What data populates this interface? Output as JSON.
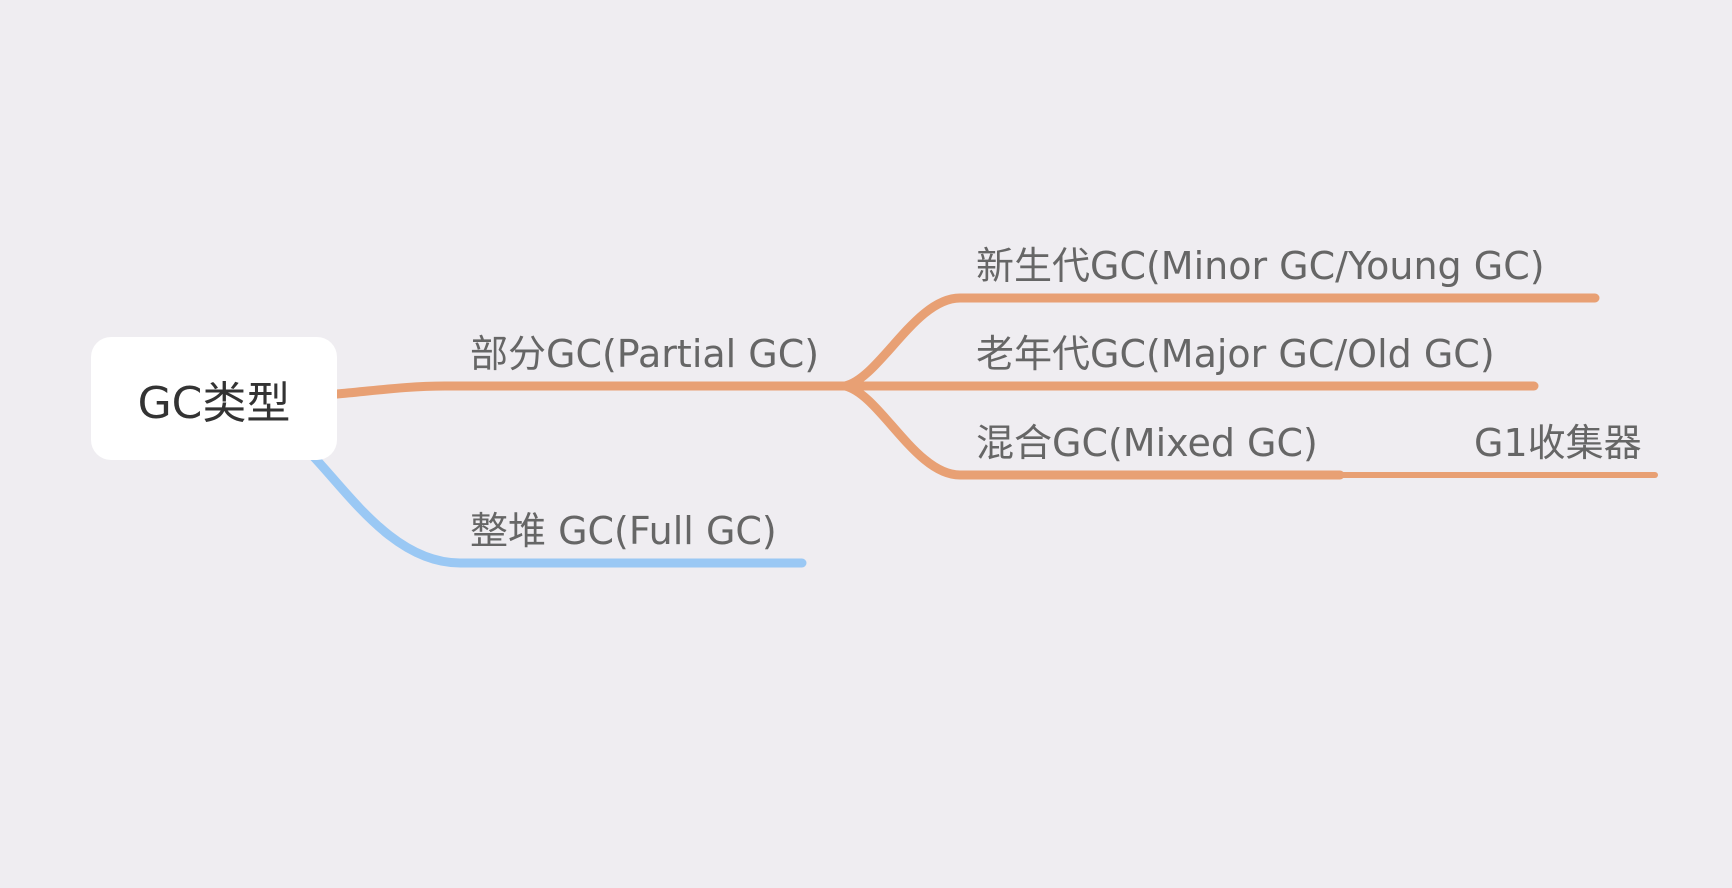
{
  "colors": {
    "background": "#efedf1",
    "root_fill": "#ffffff",
    "partial_branch": "#e8a074",
    "full_branch": "#9ac8f4",
    "label_text": "#666666",
    "root_text": "#333333"
  },
  "mindmap": {
    "root": "GC类型",
    "branches": [
      {
        "label": "部分GC(Partial GC)",
        "children": [
          {
            "label": "新生代GC(Minor GC/Young GC)"
          },
          {
            "label": "老年代GC(Major GC/Old GC)"
          },
          {
            "label": "混合GC(Mixed GC)",
            "children": [
              {
                "label": "G1收集器"
              }
            ]
          }
        ]
      },
      {
        "label": "整堆 GC(Full GC)"
      }
    ]
  }
}
